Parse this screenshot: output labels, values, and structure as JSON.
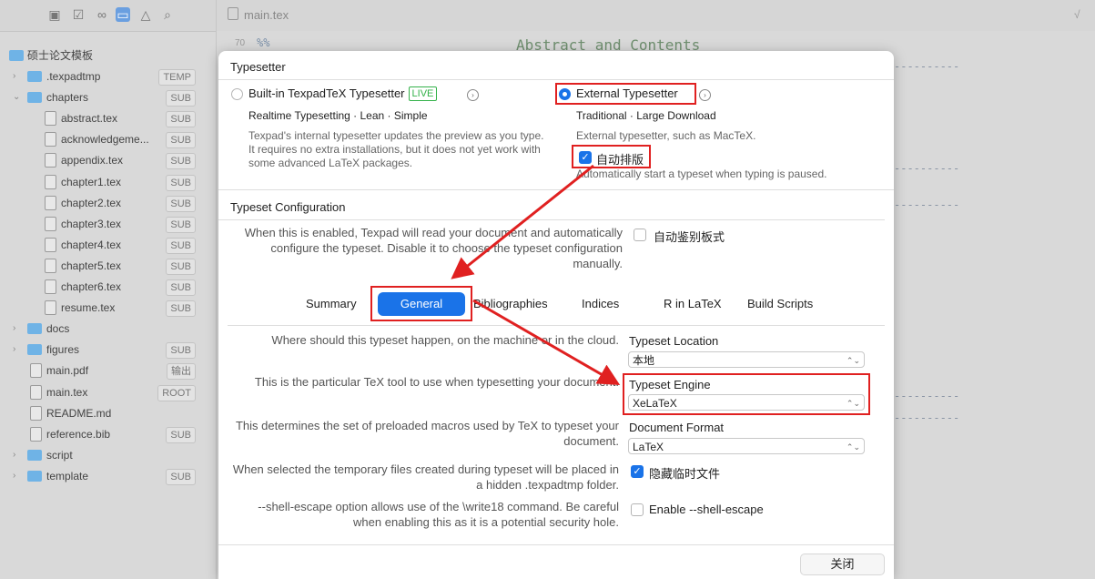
{
  "editor": {
    "tab_filename": "main.tex",
    "line_number": "70",
    "line_code": "%%",
    "heading": "Abstract and Contents",
    "dash_line": "----------",
    "right_glyph": "√"
  },
  "sidebar": {
    "root_folder": "硕士论文模板",
    "items": [
      {
        "label": ".texpadtmp",
        "badge": "TEMP",
        "kind": "folder",
        "chevron": "›",
        "indent": 0
      },
      {
        "label": "chapters",
        "badge": "SUB",
        "kind": "folder",
        "chevron": "⌄",
        "indent": 0
      },
      {
        "label": "abstract.tex",
        "badge": "SUB",
        "kind": "doc",
        "chevron": "",
        "indent": 1
      },
      {
        "label": "acknowledgeme...",
        "badge": "SUB",
        "kind": "doc",
        "chevron": "",
        "indent": 1
      },
      {
        "label": "appendix.tex",
        "badge": "SUB",
        "kind": "doc",
        "chevron": "",
        "indent": 1
      },
      {
        "label": "chapter1.tex",
        "badge": "SUB",
        "kind": "doc",
        "chevron": "",
        "indent": 1
      },
      {
        "label": "chapter2.tex",
        "badge": "SUB",
        "kind": "doc",
        "chevron": "",
        "indent": 1
      },
      {
        "label": "chapter3.tex",
        "badge": "SUB",
        "kind": "doc",
        "chevron": "",
        "indent": 1
      },
      {
        "label": "chapter4.tex",
        "badge": "SUB",
        "kind": "doc",
        "chevron": "",
        "indent": 1
      },
      {
        "label": "chapter5.tex",
        "badge": "SUB",
        "kind": "doc",
        "chevron": "",
        "indent": 1
      },
      {
        "label": "chapter6.tex",
        "badge": "SUB",
        "kind": "doc",
        "chevron": "",
        "indent": 1
      },
      {
        "label": "resume.tex",
        "badge": "SUB",
        "kind": "doc",
        "chevron": "",
        "indent": 1
      },
      {
        "label": "docs",
        "badge": "",
        "kind": "folder",
        "chevron": "›",
        "indent": 0
      },
      {
        "label": "figures",
        "badge": "SUB",
        "kind": "folder",
        "chevron": "›",
        "indent": 0
      },
      {
        "label": "main.pdf",
        "badge": "输出",
        "kind": "doc",
        "chevron": "",
        "indent": 0
      },
      {
        "label": "main.tex",
        "badge": "ROOT",
        "kind": "doc",
        "chevron": "",
        "indent": 0
      },
      {
        "label": "README.md",
        "badge": "",
        "kind": "doc",
        "chevron": "",
        "indent": 0
      },
      {
        "label": "reference.bib",
        "badge": "SUB",
        "kind": "doc",
        "chevron": "",
        "indent": 0
      },
      {
        "label": "script",
        "badge": "",
        "kind": "folder",
        "chevron": "›",
        "indent": 0
      },
      {
        "label": "template",
        "badge": "SUB",
        "kind": "folder",
        "chevron": "›",
        "indent": 0
      }
    ]
  },
  "toolbar_icons": [
    "display-icon",
    "checkbox-icon",
    "infinity-icon",
    "folder-icon",
    "warning-icon",
    "search-icon"
  ],
  "dialog": {
    "typesetter_title": "Typesetter",
    "builtin": {
      "label": "Built-in TexpadTeX Typesetter",
      "live_badge": "LIVE",
      "subtitle": "Realtime Typesetting · Lean · Simple",
      "desc": "Texpad's internal typesetter updates the preview as you type. It requires no extra installations, but it does not yet work with some advanced LaTeX packages.",
      "selected": false
    },
    "external": {
      "label": "External Typesetter",
      "subtitle": "Traditional · Large Download",
      "desc": "External typesetter, such as MacTeX.",
      "selected": true,
      "auto_label": "自动排版",
      "auto_checked": true,
      "auto_desc": "Automatically start a typeset when typing is paused."
    },
    "config_title": "Typeset Configuration",
    "config_desc": "When this is enabled, Texpad will read your document and automatically configure the typeset. Disable it to choose the typeset configuration manually.",
    "auto_detect_label": "自动鉴别板式",
    "auto_detect_checked": false,
    "tabs": [
      "Summary",
      "General",
      "Bibliographies",
      "Indices",
      "R in LaTeX",
      "Build Scripts"
    ],
    "active_tab": "General",
    "rows": {
      "location_desc": "Where should this typeset happen, on the machine or in the cloud.",
      "location_label": "Typeset Location",
      "location_value": "本地",
      "engine_desc": "This is the particular TeX tool to use when typesetting your document.",
      "engine_label": "Typeset Engine",
      "engine_value": "XeLaTeX",
      "format_desc": "This determines the set of preloaded macros used by TeX to typeset your document.",
      "format_label": "Document Format",
      "format_value": "LaTeX",
      "hidden_desc": "When selected the temporary files created during typeset will be placed in a hidden .texpadtmp folder.",
      "hidden_label": "隐藏临时文件",
      "hidden_checked": true,
      "shell_desc": "--shell-escape option allows use of the \\write18 command. Be careful when enabling this as it is a potential security hole.",
      "shell_label": "Enable --shell-escape",
      "shell_checked": false
    },
    "close_label": "关闭"
  },
  "colors": {
    "accent": "#1a73e8",
    "annotation": "#e02020",
    "live": "#34b24a",
    "folder": "#6fb3e6"
  }
}
